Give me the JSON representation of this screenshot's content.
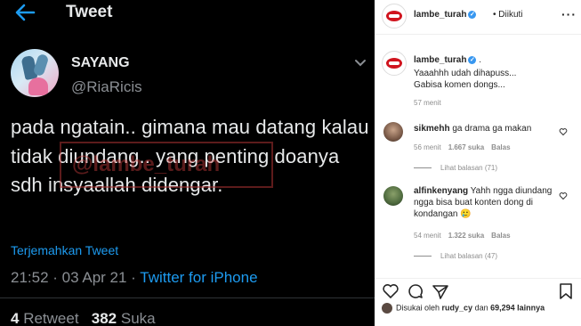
{
  "tweet": {
    "header_title": "Tweet",
    "display_name": "SAYANG",
    "handle": "@RiaRicis",
    "text": "pada ngatain.. gimana mau datang kalau tidak diundang.. yang penting doanya sdh insyaallah didengar.",
    "watermark": "@lambe_turah",
    "translate_label": "Terjemahkan Tweet",
    "time": "21:52",
    "date": "03 Apr 21",
    "source": "Twitter for iPhone",
    "retweet_count": "4",
    "retweet_label": "Retweet",
    "like_count": "382",
    "like_label": "Suka"
  },
  "instagram": {
    "header": {
      "username": "lambe_turah",
      "follow_status": "Diikuti"
    },
    "caption": {
      "username": "lambe_turah",
      "suffix": ".",
      "line1": "Yaaahhh udah dihapuss...",
      "line2": "Gabisa komen dongs...",
      "time": "57 menit"
    },
    "comments": [
      {
        "username": "sikmehh",
        "text": "ga drama ga makan",
        "time": "56 menit",
        "likes": "1.667 suka",
        "reply_label": "Balas",
        "view_replies": "Lihat balasan (71)"
      },
      {
        "username": "alfinkenyang",
        "text": "Yahh ngga diundang ngga bisa buat konten dong di kondangan 🥲",
        "time": "54 menit",
        "likes": "1.322 suka",
        "reply_label": "Balas",
        "view_replies": "Lihat balasan (47)"
      }
    ],
    "liked_by": {
      "prefix": "Disukai oleh",
      "user": "rudy_cy",
      "connector": "dan",
      "count": "69,294 lainnya"
    }
  }
}
